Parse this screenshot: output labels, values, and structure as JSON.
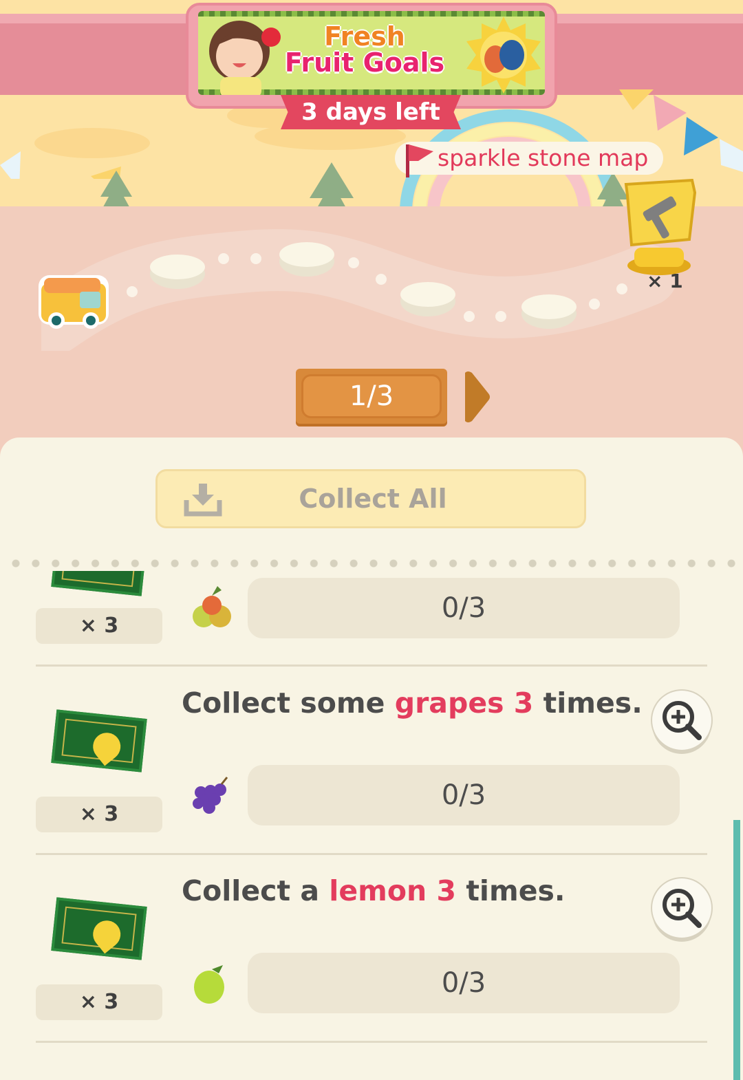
{
  "event": {
    "title_line1": "Fresh",
    "title_line2": "Fruit Goals",
    "days_left": "3 days left"
  },
  "map_link": {
    "label": "sparkle stone map"
  },
  "trophy": {
    "count": "× 1"
  },
  "pager": {
    "current": "1/3"
  },
  "collect_all": {
    "label": "Collect All"
  },
  "tasks": [
    {
      "reward_qty": "× 3",
      "fruit_icon": "apple-icon",
      "progress": "0/3"
    },
    {
      "desc_pre": "Collect some ",
      "desc_hl": "grapes 3",
      "desc_post": " times.",
      "reward_qty": "× 3",
      "fruit_icon": "grapes-icon",
      "progress": "0/3"
    },
    {
      "desc_pre": "Collect a ",
      "desc_hl": "lemon 3",
      "desc_post": " times.",
      "reward_qty": "× 3",
      "fruit_icon": "lemon-icon",
      "progress": "0/3"
    }
  ],
  "colors": {
    "accent_pink": "#e3475f",
    "highlight": "#e33c5d",
    "panel_bg": "#f8f4e4",
    "pager_orange": "#d8893a"
  }
}
